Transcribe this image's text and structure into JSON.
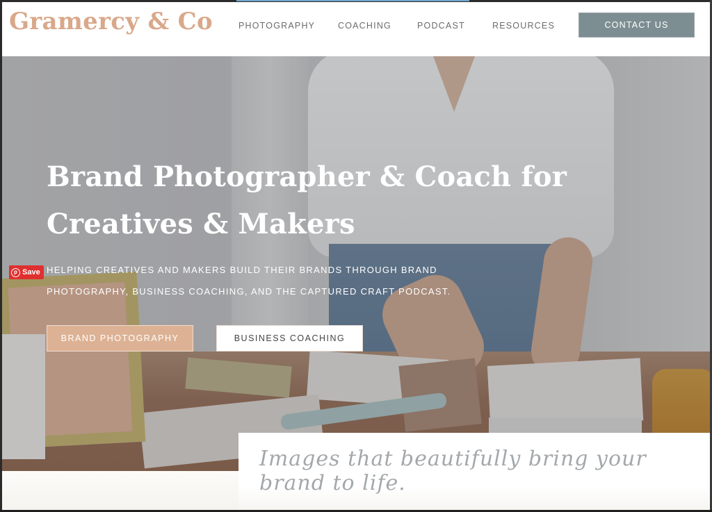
{
  "header": {
    "logo": "Gramercy & Co",
    "nav": [
      {
        "label": "PHOTOGRAPHY"
      },
      {
        "label": "COACHING"
      },
      {
        "label": "PODCAST"
      },
      {
        "label": "RESOURCES"
      }
    ],
    "contact_label": "CONTACT US"
  },
  "hero": {
    "title_line1": "Brand Photographer & Coach for",
    "title_line2": "Creatives & Makers",
    "subtitle_line1": "HELPING CREATIVES AND MAKERS BUILD THEIR BRANDS THROUGH BRAND",
    "subtitle_line2": "PHOTOGRAPHY, BUSINESS COACHING, AND THE CAPTURED CRAFT PODCAST.",
    "buttons": [
      {
        "label": "BRAND PHOTOGRAPHY"
      },
      {
        "label": "BUSINESS COACHING"
      }
    ]
  },
  "pinterest": {
    "icon": "pinterest-icon",
    "label": "Save"
  },
  "tagline": "Images that beautifully bring your brand to life.",
  "colors": {
    "brand_peach": "#d9a88a",
    "contact_button": "#7d8e92",
    "pinterest_red": "#e02f2f"
  }
}
